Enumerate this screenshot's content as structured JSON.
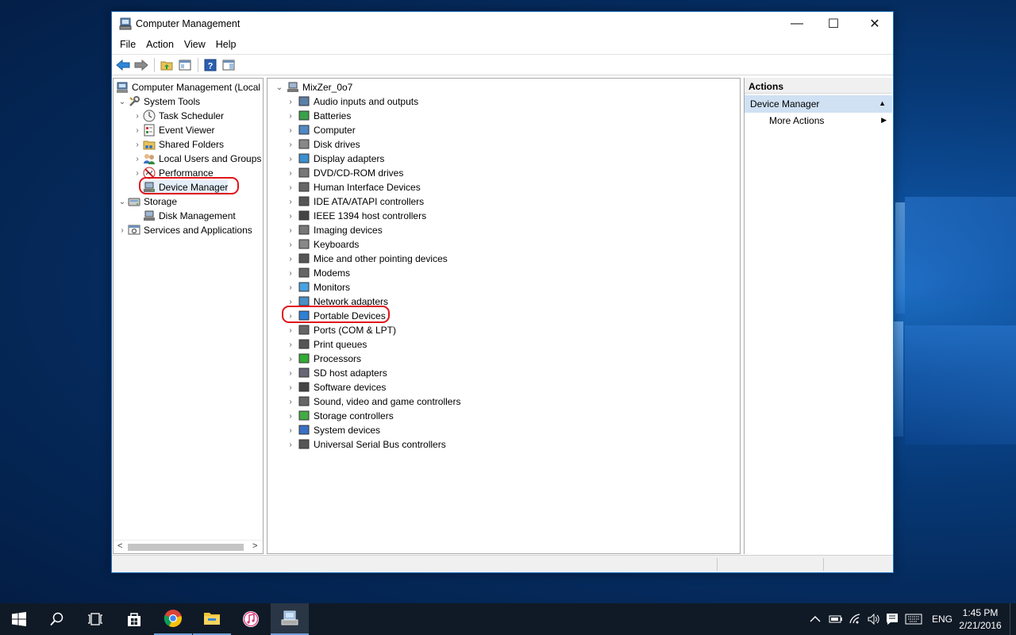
{
  "window": {
    "title": "Computer Management",
    "controls": {
      "minimize": "—",
      "maximize": "☐",
      "close": "✕"
    }
  },
  "menu": [
    "File",
    "Action",
    "View",
    "Help"
  ],
  "toolbar_icons": [
    "back-arrow-icon",
    "forward-arrow-icon",
    "up-folder-icon",
    "show-hide-tree-icon",
    "help-icon",
    "properties-pane-icon"
  ],
  "left_tree": {
    "root": "Computer Management (Local",
    "system_tools": "System Tools",
    "system_tools_items": [
      "Task Scheduler",
      "Event Viewer",
      "Shared Folders",
      "Local Users and Groups",
      "Performance",
      "Device Manager"
    ],
    "storage": "Storage",
    "storage_items": [
      "Disk Management"
    ],
    "services": "Services and Applications",
    "scroll_left": "<",
    "scroll_right": ">"
  },
  "device_tree": {
    "computer_name": "MixZer_0o7",
    "categories": [
      "Audio inputs and outputs",
      "Batteries",
      "Computer",
      "Disk drives",
      "Display adapters",
      "DVD/CD-ROM drives",
      "Human Interface Devices",
      "IDE ATA/ATAPI controllers",
      "IEEE 1394 host controllers",
      "Imaging devices",
      "Keyboards",
      "Mice and other pointing devices",
      "Modems",
      "Monitors",
      "Network adapters",
      "Portable Devices",
      "Ports (COM & LPT)",
      "Print queues",
      "Processors",
      "SD host adapters",
      "Software devices",
      "Sound, video and game controllers",
      "Storage controllers",
      "System devices",
      "Universal Serial Bus controllers"
    ]
  },
  "actions": {
    "header": "Actions",
    "section": "Device Manager",
    "more": "More Actions"
  },
  "taskbar": {
    "apps": [
      "start-icon",
      "search-icon",
      "task-view-icon",
      "store-icon",
      "chrome-icon",
      "file-explorer-icon",
      "itunes-icon",
      "computer-management-icon"
    ],
    "language": "ENG",
    "time": "1:45 PM",
    "date": "2/21/2016"
  },
  "highlight_color": "#e0151a",
  "accent_color": "#1e78c8"
}
